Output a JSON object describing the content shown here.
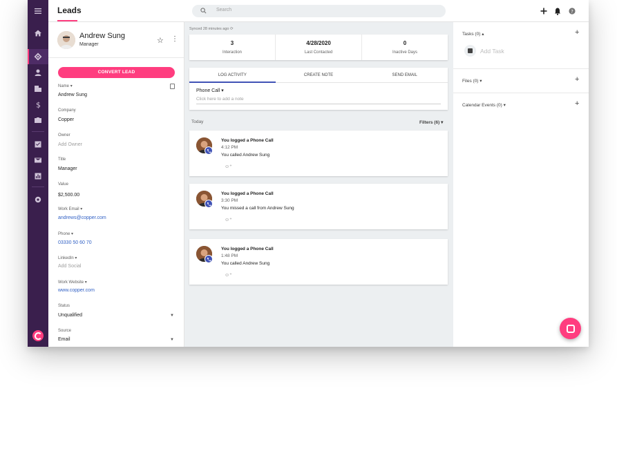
{
  "topbar": {
    "title": "Leads",
    "search_placeholder": "Search"
  },
  "nav": {
    "icons": [
      "menu-icon",
      "home-icon",
      "leads-icon",
      "person-icon",
      "company-icon",
      "dollar-icon",
      "briefcase-icon",
      "checkbox-icon",
      "mail-icon",
      "reports-icon",
      "settings-icon",
      "copper-logo"
    ]
  },
  "person": {
    "name": "Andrew Sung",
    "title": "Manager",
    "convert_label": "CONVERT LEAD"
  },
  "fields": {
    "name_label": "Name",
    "name_value": "Andrew Sung",
    "company_label": "Company",
    "company_value": "Copper",
    "owner_label": "Owner",
    "owner_value": "Add Owner",
    "title_label": "Title",
    "title_value": "Manager",
    "value_label": "Value",
    "value_value": "$2,500.00",
    "email_label": "Work Email",
    "email_value": "andrews@copper.com",
    "phone_label": "Phone",
    "phone_value": "03330 50 60 70",
    "linkedin_label": "LinkedIn",
    "linkedin_value": "Add Social",
    "website_label": "Work Website",
    "website_value": "www.copper.com",
    "status_label": "Status",
    "status_value": "Unqualified",
    "source_label": "Source",
    "source_value": "Email"
  },
  "center": {
    "synced": "Synced 28 minutes ago",
    "stats": [
      {
        "value": "3",
        "label": "Interaction"
      },
      {
        "value": "4/28/2020",
        "label": "Last Contacted"
      },
      {
        "value": "0",
        "label": "Inactive Days"
      }
    ],
    "tabs": [
      "LOG ACTIVITY",
      "CREATE NOTE",
      "SEND EMAIL"
    ],
    "activity_type": "Phone Call",
    "note_placeholder": "Click here to add a note",
    "today": "Today",
    "filters": "Filters (6)",
    "cards": [
      {
        "title": "You logged a Phone Call",
        "time": "4:12 PM",
        "body": "You called Andrew Sung"
      },
      {
        "title": "You logged a Phone Call",
        "time": "3:30 PM",
        "body": "You missed a call from Andrew Sung"
      },
      {
        "title": "You logged a Phone Call",
        "time": "1:48 PM",
        "body": "You called Andrew Sung"
      }
    ]
  },
  "right": {
    "tasks": "Tasks (0)",
    "add_task": "Add Task",
    "files": "Files (0)",
    "calendar": "Calendar Events (0)"
  },
  "colors": {
    "accent": "#ff3d7f",
    "nav": "#3a1f4d",
    "link": "#2f5fc4",
    "tab_active": "#3f51b5"
  }
}
